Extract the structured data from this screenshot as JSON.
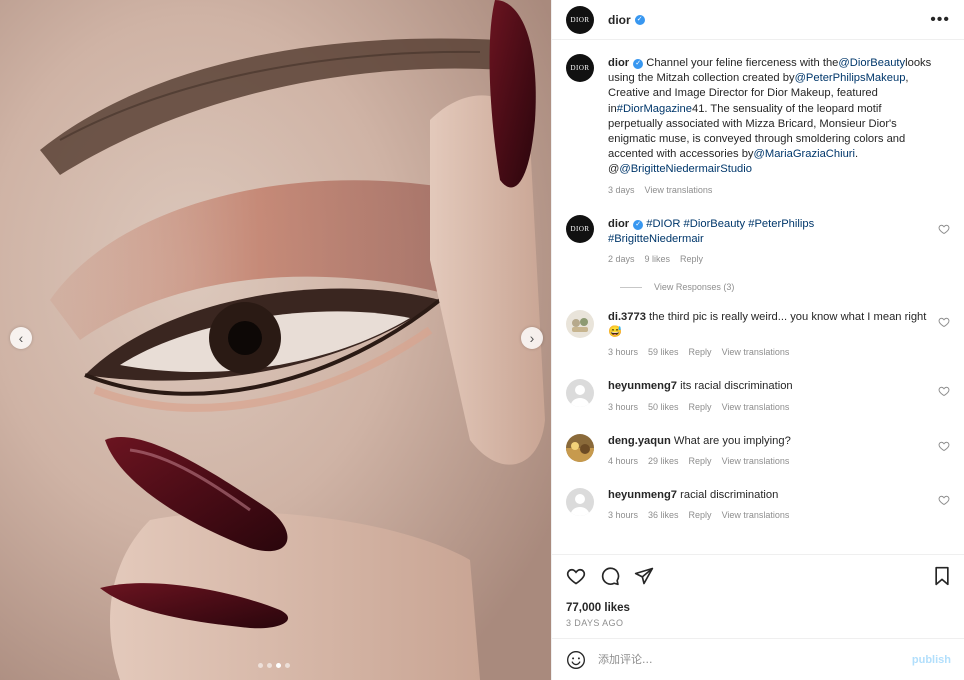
{
  "media": {
    "prev_arrow": "‹",
    "next_arrow": "›",
    "slide_count": 4,
    "active_slide": 2
  },
  "header": {
    "username": "dior",
    "avatar_text": "DIOR",
    "verified_icon": "✓",
    "more_icon": "•••"
  },
  "caption": {
    "username": "dior",
    "avatar_text": "DIOR",
    "t1": " Channel your feline fierceness with the",
    "m1": "@DiorBeauty",
    "t2": "looks using the Mitzah collection created by",
    "m2": "@PeterPhilipsMakeup",
    "t3": ", Creative and Image Director for Dior Makeup, featured in",
    "m3": "#DiorMagazine",
    "t4": "41. The sensuality of the leopard motif perpetually associated with Mizza Bricard, Monsieur Dior's enigmatic muse, is conveyed through smoldering colors and accented with accessories by",
    "m4": "@MariaGraziaChiuri",
    "t5": ".",
    "t6": "@",
    "m5": "@BrigitteNiedermairStudio",
    "time": "3 days",
    "translate": "View translations"
  },
  "dior_comment": {
    "username": "dior",
    "avatar_text": "DIOR",
    "tags": [
      " #DIOR",
      " #DiorBeauty",
      " #PeterPhilips",
      "#BrigitteNiedermair"
    ],
    "time": "2 days",
    "likes": "9 likes",
    "reply": "Reply",
    "view_responses": "View Responses (3)"
  },
  "comments": [
    {
      "username": "di.3773",
      "text": " the third pic is really weird... you know what I mean right",
      "emoji": "😅",
      "time": "3 hours",
      "likes": "59 likes",
      "reply": "Reply",
      "translate": "View translations"
    },
    {
      "username": "heyunmeng7",
      "text": " its racial discrimination",
      "time": "3 hours",
      "likes": "50 likes",
      "reply": "Reply",
      "translate": "View translations"
    },
    {
      "username": "deng.yaqun",
      "text": " What are you implying?",
      "time": "4 hours",
      "likes": "29 likes",
      "reply": "Reply",
      "translate": "View translations"
    },
    {
      "username": "heyunmeng7",
      "text": " racial discrimination",
      "time": "3 hours",
      "likes": "36 likes",
      "reply": "Reply",
      "translate": "View translations"
    }
  ],
  "actions": {
    "likes": "77,000 likes",
    "posted": "3 DAYS AGO"
  },
  "add_comment": {
    "placeholder": "添加评论...",
    "publish": "publish"
  },
  "colors": {
    "link": "#00376b",
    "muted": "#8e8e8e",
    "verified": "#3897f0",
    "publish_disabled": "#b2dffc"
  }
}
